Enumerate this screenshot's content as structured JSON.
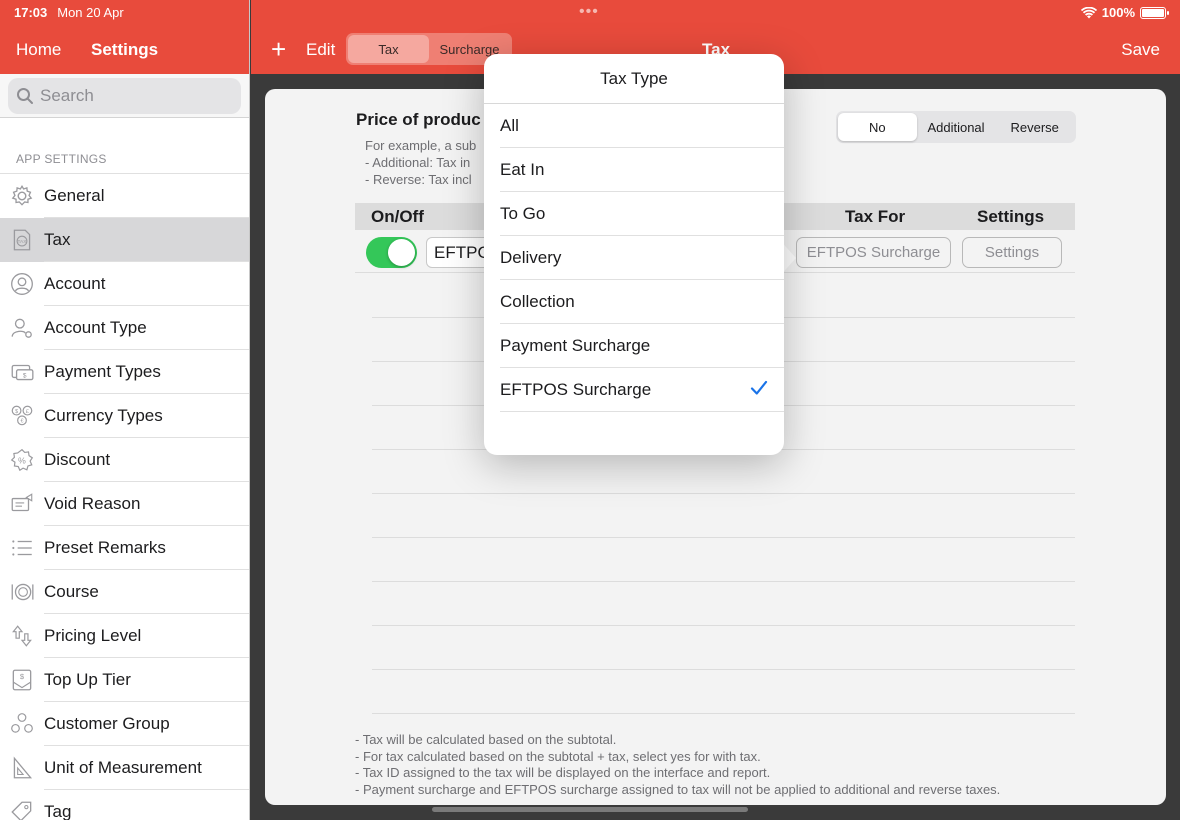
{
  "status": {
    "time": "17:03",
    "date": "Mon 20 Apr",
    "battery": "100%",
    "battery_level": 1.0
  },
  "sidebar": {
    "home": "Home",
    "title": "Settings",
    "search_placeholder": "Search",
    "section": "APP SETTINGS",
    "items": [
      {
        "label": "General",
        "icon": "gear-icon"
      },
      {
        "label": "Tax",
        "icon": "tax-doc-icon"
      },
      {
        "label": "Account",
        "icon": "person-icon"
      },
      {
        "label": "Account Type",
        "icon": "person-gear-icon"
      },
      {
        "label": "Payment Types",
        "icon": "payment-icon"
      },
      {
        "label": "Currency Types",
        "icon": "currency-icon"
      },
      {
        "label": "Discount",
        "icon": "discount-icon"
      },
      {
        "label": "Void Reason",
        "icon": "void-icon"
      },
      {
        "label": "Preset Remarks",
        "icon": "list-icon"
      },
      {
        "label": "Course",
        "icon": "course-icon"
      },
      {
        "label": "Pricing Level",
        "icon": "pricing-icon"
      },
      {
        "label": "Top Up Tier",
        "icon": "topup-icon"
      },
      {
        "label": "Customer Group",
        "icon": "group-icon"
      },
      {
        "label": "Unit of Measurement",
        "icon": "ruler-icon"
      },
      {
        "label": "Tag",
        "icon": "tag-icon"
      }
    ],
    "active_index": 1
  },
  "header": {
    "add": "+",
    "edit": "Edit",
    "tabs": [
      "Tax",
      "Surcharge"
    ],
    "title": "Tax",
    "save": "Save"
  },
  "content": {
    "price_title": "Price of produc",
    "desc_lines": [
      "For example, a sub",
      "- Additional: Tax in",
      "- Reverse: Tax incl"
    ],
    "tax_mode": [
      "No",
      "Additional",
      "Reverse"
    ],
    "table_headers": {
      "onoff": "On/Off",
      "name": "T",
      "tax_for": "Tax For",
      "settings": "Settings"
    },
    "row": {
      "name": "EFTPOS",
      "tax_for": "EFTPOS Surcharge",
      "settings": "Settings",
      "enabled": true
    },
    "notes": [
      "- Tax will be calculated based on the subtotal.",
      "- For tax calculated based on the subtotal + tax, select yes for with tax.",
      "- Tax ID assigned to the tax will be displayed on the interface and report.",
      "- Payment surcharge and EFTPOS surcharge assigned to tax will not be applied to additional and reverse taxes."
    ]
  },
  "popover": {
    "title": "Tax Type",
    "options": [
      "All",
      "Eat In",
      "To Go",
      "Delivery",
      "Collection",
      "Payment Surcharge",
      "EFTPOS Surcharge"
    ],
    "selected": "EFTPOS Surcharge"
  },
  "colors": {
    "brand": "#e84b3c",
    "toggle_on": "#34c759",
    "check": "#1a73e8"
  }
}
